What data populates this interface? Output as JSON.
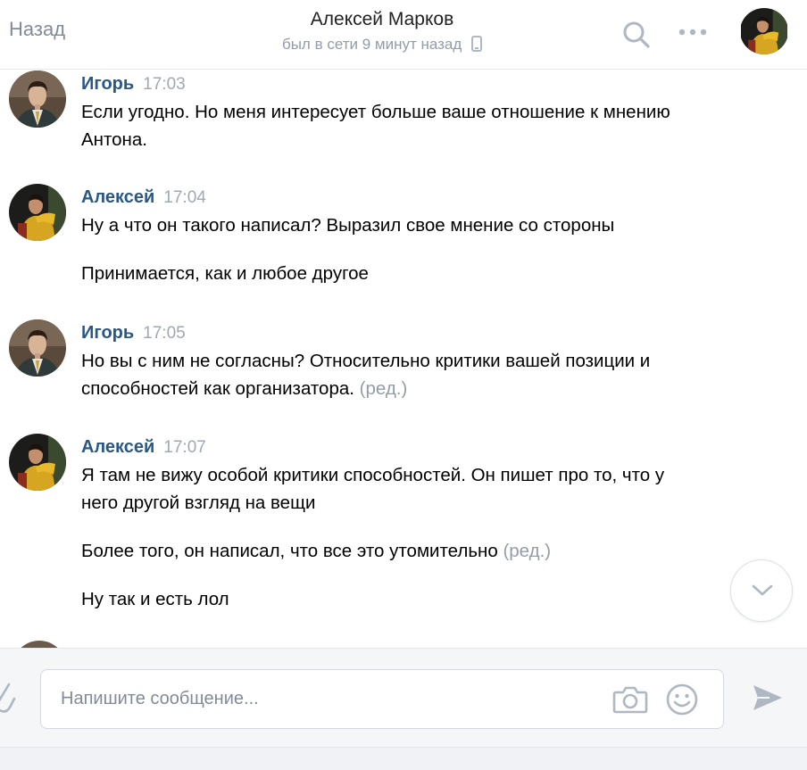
{
  "header": {
    "back_label": "Назад",
    "title": "Алексей Марков",
    "status": "был в сети 9 минут назад",
    "search_icon": "search-icon",
    "more_icon": "more-dots-icon"
  },
  "messages": [
    {
      "author": "Игорь",
      "time": "17:03",
      "avatar": "igor",
      "texts": [
        {
          "text": "Если угодно. Но меня интересует больше ваше отношение к мнению Антона.",
          "edited": ""
        }
      ]
    },
    {
      "author": "Алексей",
      "time": "17:04",
      "avatar": "aleksey",
      "texts": [
        {
          "text": "Ну а что он такого написал? Выразил свое мнение со стороны",
          "edited": ""
        },
        {
          "text": "Принимается, как и любое другое",
          "edited": ""
        }
      ]
    },
    {
      "author": "Игорь",
      "time": "17:05",
      "avatar": "igor",
      "texts": [
        {
          "text": "Но вы с ним не согласны? Относительно критики вашей позиции и способностей как организатора.",
          "edited": "(ред.)"
        }
      ]
    },
    {
      "author": "Алексей",
      "time": "17:07",
      "avatar": "aleksey",
      "texts": [
        {
          "text": "Я там не вижу особой критики способностей. Он пишет про то, что у него другой взгляд на вещи",
          "edited": ""
        },
        {
          "text": "Более того, он написал, что все это утомительно",
          "edited": "(ред.)"
        },
        {
          "text": "Ну так и есть лол",
          "edited": ""
        }
      ]
    }
  ],
  "composer": {
    "placeholder": "Напишите сообщение...",
    "attach_icon": "paperclip-icon",
    "camera_icon": "camera-icon",
    "emoji_icon": "smile-icon",
    "send_icon": "send-icon"
  },
  "colors": {
    "author": "#2a5885",
    "muted": "#939ca8",
    "icon": "#aeb7c2",
    "composer_bg": "#f5f6f8"
  }
}
